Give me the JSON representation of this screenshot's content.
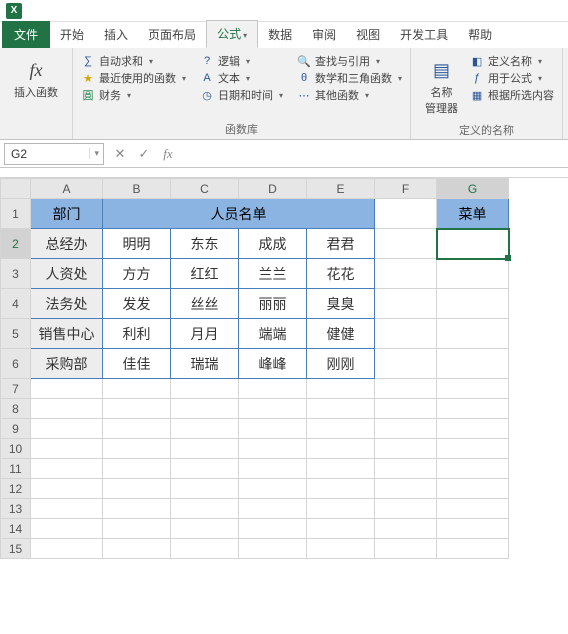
{
  "app": {
    "excel_badge": "X"
  },
  "tabs": {
    "file": "文件",
    "home": "开始",
    "insert": "插入",
    "layout": "页面布局",
    "formula": "公式",
    "data": "数据",
    "review": "审阅",
    "view": "视图",
    "dev": "开发工具",
    "help": "帮助"
  },
  "ribbon": {
    "insert_fn": "插入函数",
    "fx": "fx",
    "autosum": "自动求和",
    "recent": "最近使用的函数",
    "financial": "财务",
    "logical": "逻辑",
    "text": "文本",
    "datetime": "日期和时间",
    "lookup": "查找与引用",
    "math": "数学和三角函数",
    "other": "其他函数",
    "fn_lib": "函数库",
    "name_mgr": "名称\n管理器",
    "def_name": "定义名称",
    "use_in_fn": "用于公式",
    "from_sel": "根据所选内容",
    "defined_names": "定义的名称"
  },
  "fnbar": {
    "namebox": "G2",
    "cancel": "✕",
    "confirm": "✓",
    "fx": "fx"
  },
  "cols": [
    "A",
    "B",
    "C",
    "D",
    "E",
    "F",
    "G"
  ],
  "rows": [
    "1",
    "2",
    "3",
    "4",
    "5",
    "6",
    "7",
    "8",
    "9",
    "10",
    "11",
    "12",
    "13",
    "14",
    "15"
  ],
  "hdr": {
    "dept": "部门",
    "roster": "人员名单",
    "menu": "菜单"
  },
  "data": {
    "depts": [
      "总经办",
      "人资处",
      "法务处",
      "销售中心",
      "采购部"
    ],
    "names": [
      [
        "明明",
        "东东",
        "成成",
        "君君"
      ],
      [
        "方方",
        "红红",
        "兰兰",
        "花花"
      ],
      [
        "发发",
        "丝丝",
        "丽丽",
        "臭臭"
      ],
      [
        "利利",
        "月月",
        "端端",
        "健健"
      ],
      [
        "佳佳",
        "瑞瑞",
        "峰峰",
        "刚刚"
      ]
    ]
  }
}
